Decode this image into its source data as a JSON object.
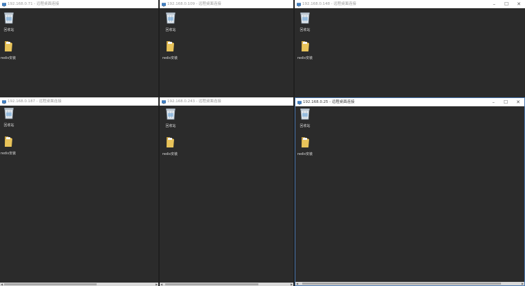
{
  "windows": [
    {
      "title": "192.168.0.71 - 远程桌面连接",
      "active": false,
      "icons": [
        {
          "label": "回收站",
          "type": "recycle-bin"
        },
        {
          "label": "redis安装",
          "type": "folder"
        }
      ]
    },
    {
      "title": "192.168.0.109 - 远程桌面连接",
      "active": false,
      "icons": [
        {
          "label": "回收站",
          "type": "recycle-bin"
        },
        {
          "label": "redis安装",
          "type": "folder"
        }
      ]
    },
    {
      "title": "192.168.0.148 - 远程桌面连接",
      "active": false,
      "icons": [
        {
          "label": "回收站",
          "type": "recycle-bin"
        },
        {
          "label": "redis安装",
          "type": "folder"
        }
      ]
    },
    {
      "title": "192.168.0.187 - 远程桌面连接",
      "active": false,
      "icons": [
        {
          "label": "回收站",
          "type": "recycle-bin"
        },
        {
          "label": "redis安装",
          "type": "folder"
        }
      ]
    },
    {
      "title": "192.168.0.243 - 远程桌面连接",
      "active": false,
      "icons": [
        {
          "label": "回收站",
          "type": "recycle-bin"
        },
        {
          "label": "redis安装",
          "type": "folder"
        }
      ]
    },
    {
      "title": "192.168.0.25 - 远程桌面连接",
      "active": true,
      "icons": [
        {
          "label": "回收站",
          "type": "recycle-bin"
        },
        {
          "label": "redis安装",
          "type": "folder"
        }
      ]
    }
  ],
  "window_controls": {
    "minimize": "–",
    "maximize": "☐",
    "close": "✕"
  },
  "colors": {
    "desktop": "#2b2b2b",
    "titlebar": "#ffffff",
    "active_border": "#4a78b0",
    "folder": "#e8c35a"
  }
}
